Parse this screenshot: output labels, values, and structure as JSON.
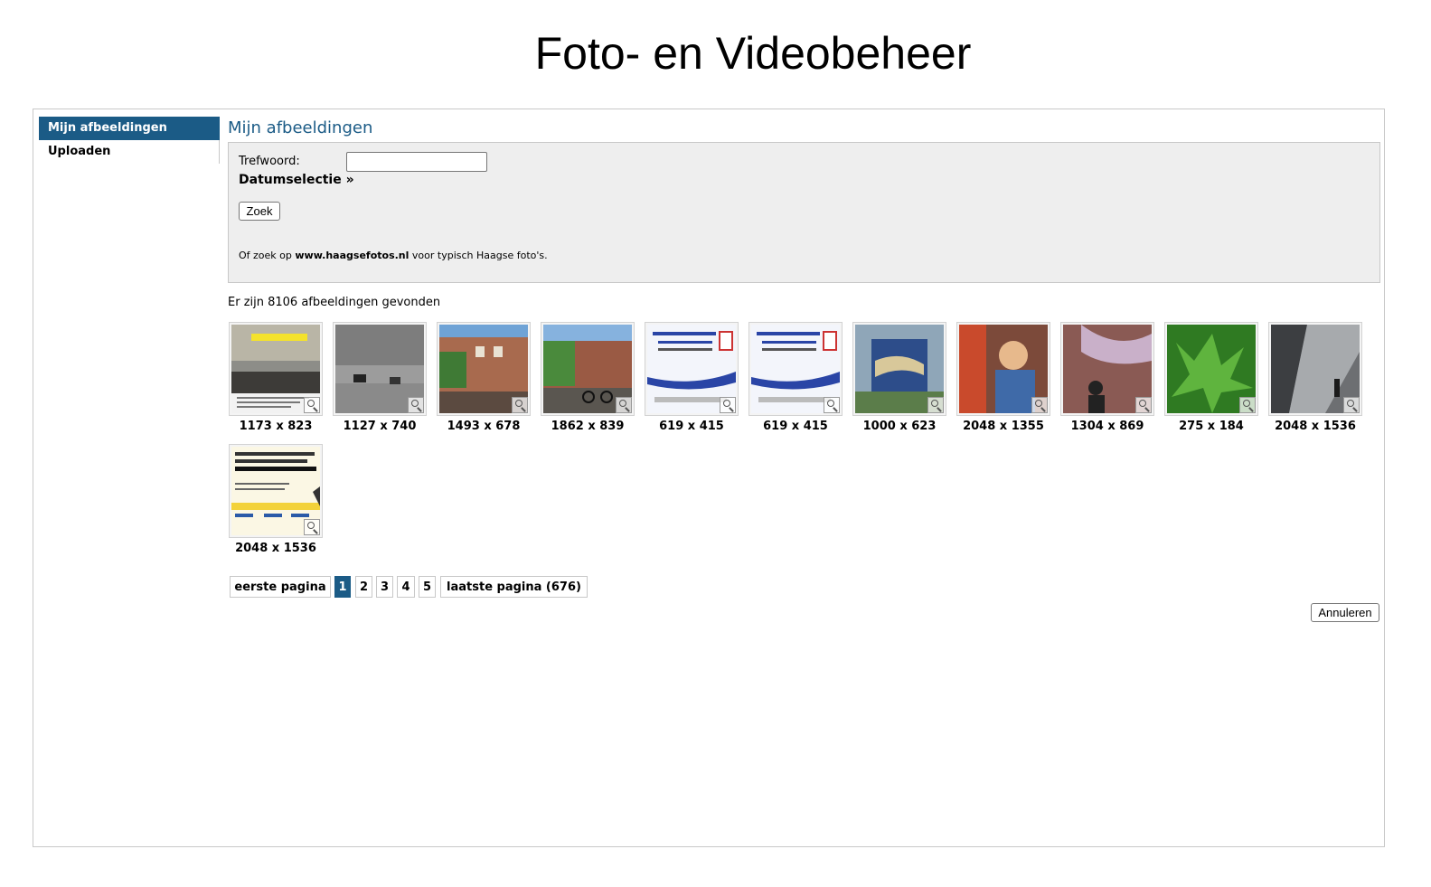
{
  "page": {
    "title": "Foto- en Videobeheer"
  },
  "sidebar": {
    "items": [
      {
        "label": "Mijn afbeeldingen",
        "active": true
      },
      {
        "label": "Uploaden",
        "active": false
      }
    ]
  },
  "main": {
    "heading": "Mijn afbeeldingen",
    "search": {
      "keyword_label": "Trefwoord:",
      "keyword_value": "",
      "date_selection_label": "Datumselectie »",
      "search_button": "Zoek",
      "hint_prefix": "Of zoek op",
      "hint_link": "www.haagsefotos.nl",
      "hint_suffix": "voor typisch Haagse foto's."
    },
    "result_count_text": "Er zijn 8106 afbeeldingen gevonden",
    "images": [
      {
        "dims": "1173 x 823",
        "icon": "zoom-icon"
      },
      {
        "dims": "1127 x 740",
        "icon": "zoom-icon"
      },
      {
        "dims": "1493 x 678",
        "icon": "zoom-icon"
      },
      {
        "dims": "1862 x 839",
        "icon": "zoom-icon"
      },
      {
        "dims": "619 x 415",
        "icon": "zoom-icon"
      },
      {
        "dims": "619 x 415",
        "icon": "zoom-icon"
      },
      {
        "dims": "1000 x 623",
        "icon": "zoom-icon"
      },
      {
        "dims": "2048 x 1355",
        "icon": "zoom-icon"
      },
      {
        "dims": "1304 x 869",
        "icon": "zoom-icon"
      },
      {
        "dims": "275 x 184",
        "icon": "zoom-icon"
      },
      {
        "dims": "2048 x 1536",
        "icon": "zoom-icon"
      },
      {
        "dims": "2048 x 1536",
        "icon": "zoom-icon"
      }
    ],
    "pagination": {
      "first_label": "eerste pagina",
      "pages": [
        "1",
        "2",
        "3",
        "4",
        "5"
      ],
      "current_page": "1",
      "last_label": "laatste pagina (676)"
    },
    "cancel_button": "Annuleren"
  },
  "colors": {
    "accent": "#1b5b86",
    "panel_bg": "#eeeeee",
    "border": "#c8c8c8"
  }
}
